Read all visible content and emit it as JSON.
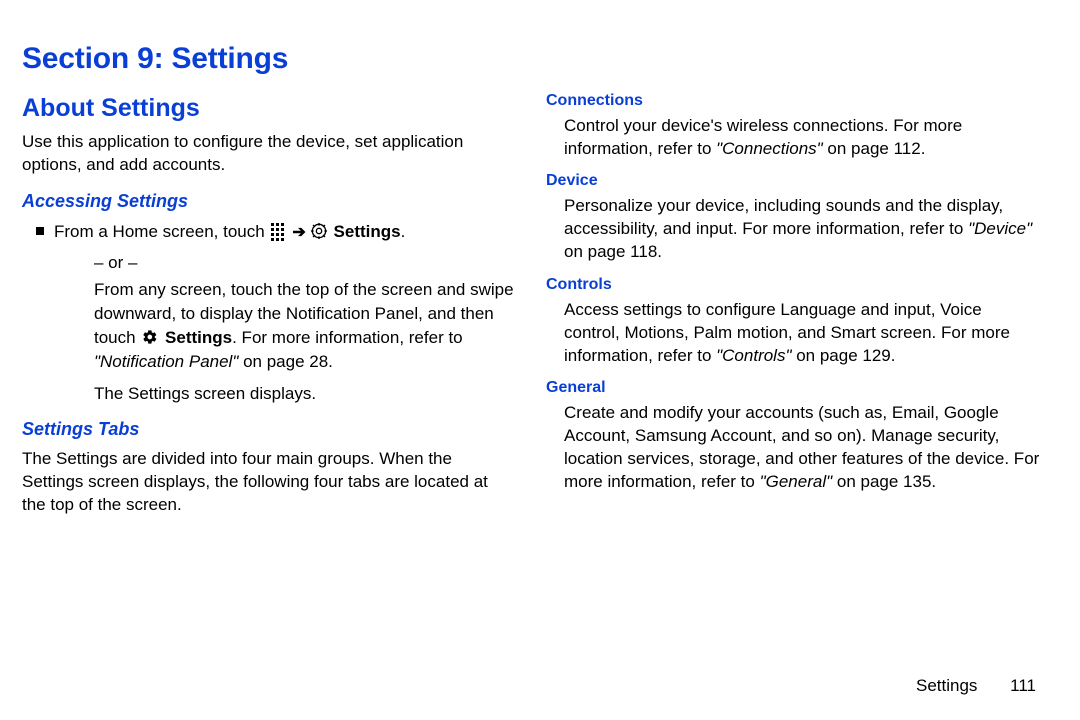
{
  "section_title": "Section 9: Settings",
  "left": {
    "about_heading": "About Settings",
    "about_text": "Use this application to configure the device, set application options, and add accounts.",
    "accessing_heading": "Accessing Settings",
    "step_pre": "From a Home screen, touch ",
    "step_settings_label": " Settings",
    "step_post": ".",
    "or_text": "– or –",
    "cont1a": "From any screen, touch the top of the screen and swipe downward, to display the Notification Panel, and then touch ",
    "cont1_settings": " Settings",
    "cont1b": ". For more information, refer to ",
    "cont1_ref": "\"Notification Panel\"",
    "cont1c": " on page 28.",
    "cont2": "The Settings screen displays.",
    "tabs_heading": "Settings Tabs",
    "tabs_text": "The Settings are divided into four main groups. When the Settings screen displays, the following four tabs are located at the top of the screen."
  },
  "right": {
    "connections": {
      "heading": "Connections",
      "text_a": "Control your device's wireless connections. For more information, refer to ",
      "ref": "\"Connections\"",
      "text_b": " on page 112."
    },
    "device": {
      "heading": "Device",
      "text_a": "Personalize your device, including sounds and the display, accessibility, and input. For more information, refer to ",
      "ref": "\"Device\"",
      "text_b": " on page 118."
    },
    "controls": {
      "heading": "Controls",
      "text_a": "Access settings to configure Language and input, Voice control, Motions, Palm motion, and Smart screen. For more information, refer to ",
      "ref": "\"Controls\"",
      "text_b": " on page 129."
    },
    "general": {
      "heading": "General",
      "text_a": "Create and modify your accounts (such as, Email, Google Account, Samsung Account, and so on). Manage security, location services, storage, and other features of the device. For more information, refer to ",
      "ref": "\"General\"",
      "text_b": " on page 135."
    }
  },
  "footer": {
    "label": "Settings",
    "page": "111"
  }
}
